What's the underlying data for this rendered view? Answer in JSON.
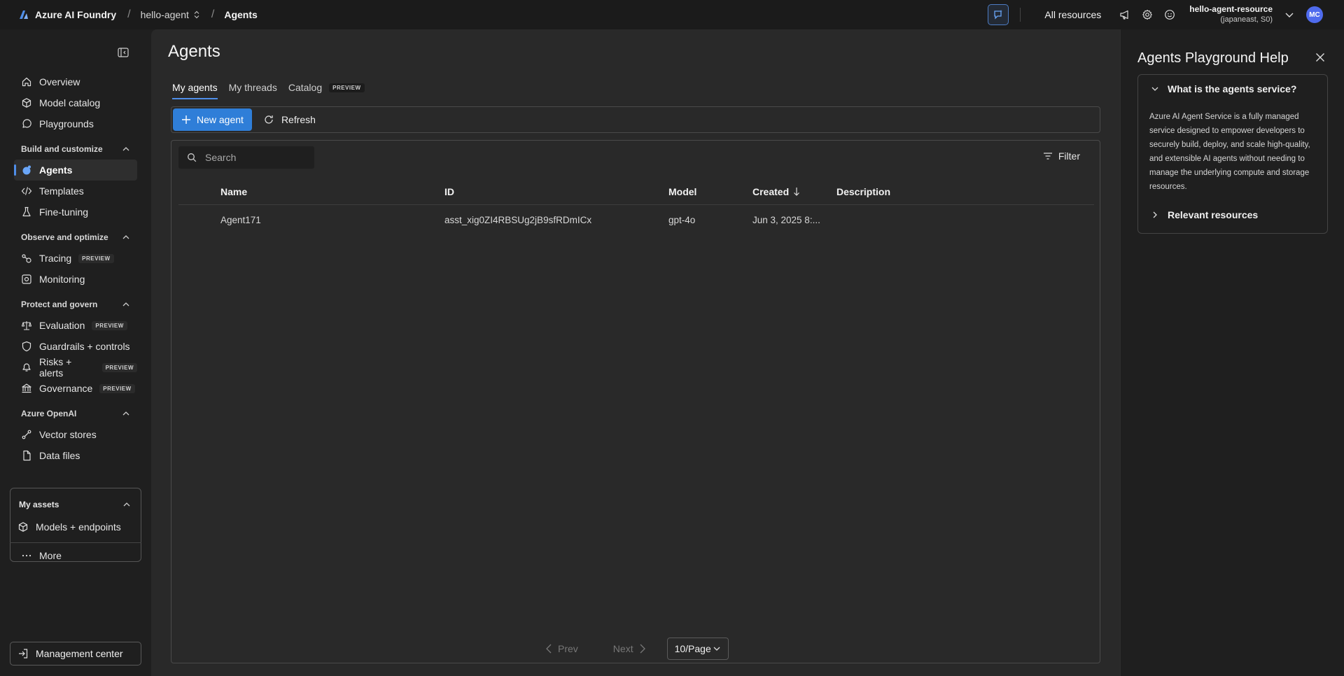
{
  "topbar": {
    "brand": "Azure AI Foundry",
    "breadcrumb": [
      {
        "label": "hello-agent"
      },
      {
        "label": "Agents"
      }
    ],
    "all_resources": "All resources",
    "account_name": "hello-agent-resource",
    "account_sub": "(japaneast, S0)",
    "avatar_initials": "MC",
    "accent_color": "#4f8ee8"
  },
  "sidebar": {
    "items_top": [
      {
        "label": "Overview",
        "icon": "home-icon"
      },
      {
        "label": "Model catalog",
        "icon": "cube-icon"
      },
      {
        "label": "Playgrounds",
        "icon": "chat-icon"
      }
    ],
    "sections": [
      {
        "title": "Build and customize",
        "items": [
          {
            "label": "Agents",
            "icon": "agent-icon",
            "active": true
          },
          {
            "label": "Templates",
            "icon": "code-icon"
          },
          {
            "label": "Fine-tuning",
            "icon": "beaker-icon"
          }
        ]
      },
      {
        "title": "Observe and optimize",
        "items": [
          {
            "label": "Tracing",
            "icon": "tracing-icon",
            "badge": "PREVIEW"
          },
          {
            "label": "Monitoring",
            "icon": "monitor-icon"
          }
        ]
      },
      {
        "title": "Protect and govern",
        "items": [
          {
            "label": "Evaluation",
            "icon": "scale-icon",
            "badge": "PREVIEW"
          },
          {
            "label": "Guardrails + controls",
            "icon": "shield-icon"
          },
          {
            "label": "Risks + alerts",
            "icon": "alert-icon",
            "badge": "PREVIEW"
          },
          {
            "label": "Governance",
            "icon": "building-icon",
            "badge": "PREVIEW"
          }
        ]
      },
      {
        "title": "Azure OpenAI",
        "items": [
          {
            "label": "Vector stores",
            "icon": "vector-icon"
          },
          {
            "label": "Data files",
            "icon": "file-icon"
          }
        ]
      }
    ],
    "assets": {
      "title": "My assets",
      "item": "Models + endpoints"
    },
    "more": "More",
    "management": "Management center"
  },
  "main": {
    "title": "Agents",
    "tabs": [
      {
        "label": "My agents",
        "active": true
      },
      {
        "label": "My threads"
      },
      {
        "label": "Catalog",
        "badge": "PREVIEW"
      }
    ],
    "toolbar": {
      "new_agent": "New agent",
      "refresh": "Refresh"
    },
    "search_placeholder": "Search",
    "filter": "Filter",
    "columns": [
      "Name",
      "ID",
      "Model",
      "Created",
      "Description"
    ],
    "rows": [
      {
        "name": "Agent171",
        "id": "asst_xig0ZI4RBSUg2jB9sfRDmICx",
        "model": "gpt-4o",
        "created": "Jun 3, 2025 8:...",
        "description": ""
      }
    ],
    "pager": {
      "prev": "Prev",
      "next": "Next",
      "page_size": "10/Page"
    }
  },
  "help": {
    "title": "Agents Playground Help",
    "section1_title": "What is the agents service?",
    "section1_body": "Azure AI Agent Service is a fully managed service designed to empower developers to securely build, deploy, and scale high-quality, and extensible AI agents without needing to manage the underlying compute and storage resources.",
    "section2_title": "Relevant resources"
  }
}
